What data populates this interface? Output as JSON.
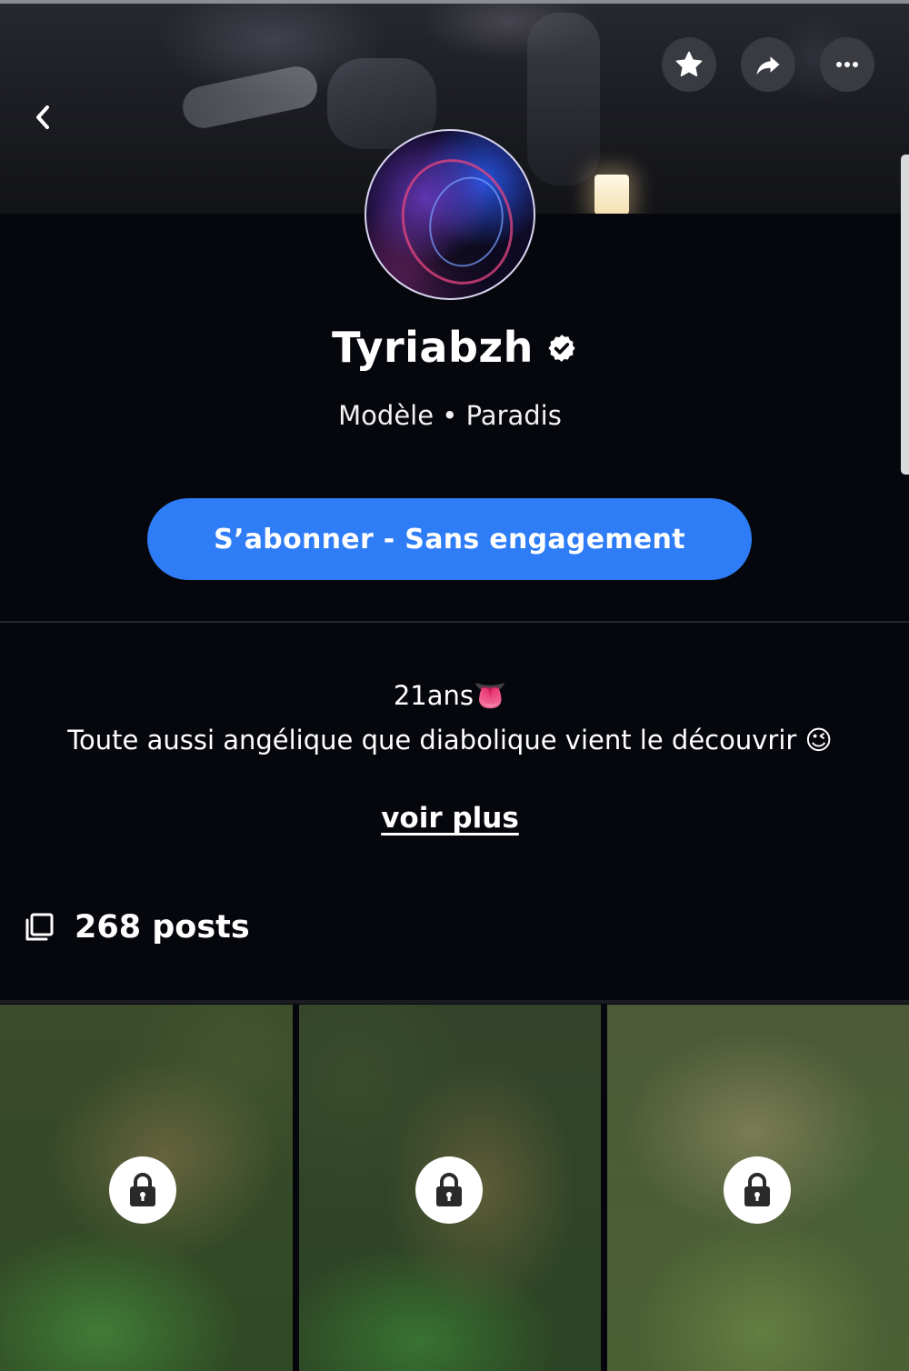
{
  "header": {
    "back_icon": "chevron-left-icon",
    "actions": [
      {
        "icon": "star-icon"
      },
      {
        "icon": "share-icon"
      },
      {
        "icon": "more-icon"
      }
    ]
  },
  "profile": {
    "name": "Tyriabzh",
    "verified_icon": "verified-badge-icon",
    "subtitle": "Modèle • Paradis"
  },
  "subscribe_label": "S’abonner - Sans engagement",
  "bio": {
    "line1": "21ans👅",
    "line2": "Toute aussi angélique que diabolique vient le découvrir 😉",
    "more_link": "voir plus"
  },
  "posts": {
    "icon": "stacked-squares-icon",
    "count_label": "268 posts"
  },
  "grid": {
    "tiles": [
      {
        "locked": true,
        "icon": "lock-icon"
      },
      {
        "locked": true,
        "icon": "lock-icon"
      },
      {
        "locked": true,
        "icon": "lock-icon"
      }
    ]
  },
  "colors": {
    "background": "#05070c",
    "accent": "#2e7cf6",
    "text": "#ffffff"
  }
}
